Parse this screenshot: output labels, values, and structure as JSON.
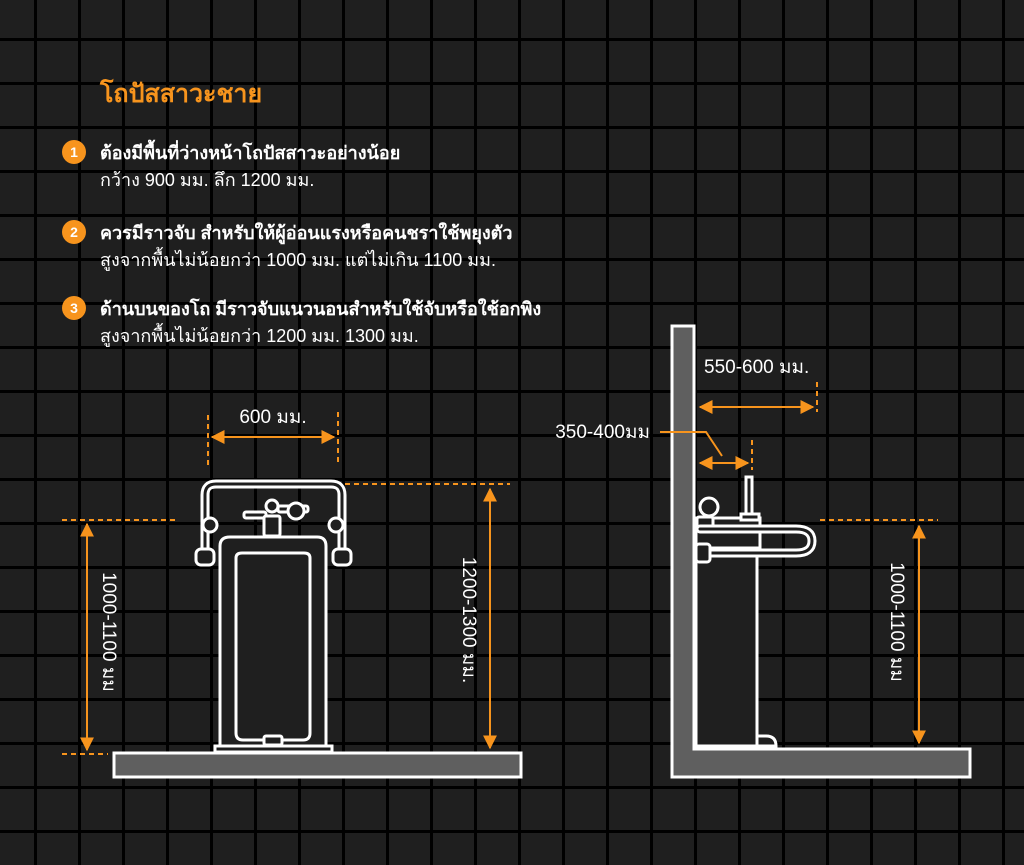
{
  "title": "โถปัสสาวะชาย",
  "rules": [
    {
      "number": "1",
      "heading": "ต้องมีพื้นที่ว่างหน้าโถปัสสาวะอย่างน้อย",
      "text": "กว้าง 900 มม. ลึก 1200 มม."
    },
    {
      "number": "2",
      "heading": "ควรมีราวจับ สำหรับให้ผู้อ่อนแรงหรือคนชราใช้พยุงตัว",
      "text": "สูงจากพื้นไม่น้อยกว่า 1000 มม. แต่ไม่เกิน 1100 มม."
    },
    {
      "number": "3",
      "heading": "ด้านบนของโถ มีราวจับแนวนอนสำหรับใช้จับหรือใช้อกพิง",
      "text": "สูงจากพื้นไม่น้อยกว่า 1200 มม. 1300 มม."
    }
  ],
  "front_view": {
    "width_label": "600 มม.",
    "grab_bar_height_label": "1000-1100 มม",
    "top_bar_height_label": "1200-1300 มม."
  },
  "side_view": {
    "reach_label": "550-600 มม.",
    "bar_depth_label": "350-400มม",
    "grab_bar_height_label": "1000-1100 มม"
  },
  "colors": {
    "accent": "#f7941d",
    "background": "#1f1f1f",
    "grid": "#000000",
    "floor_fill": "#5f5f5f",
    "line": "#ffffff"
  }
}
